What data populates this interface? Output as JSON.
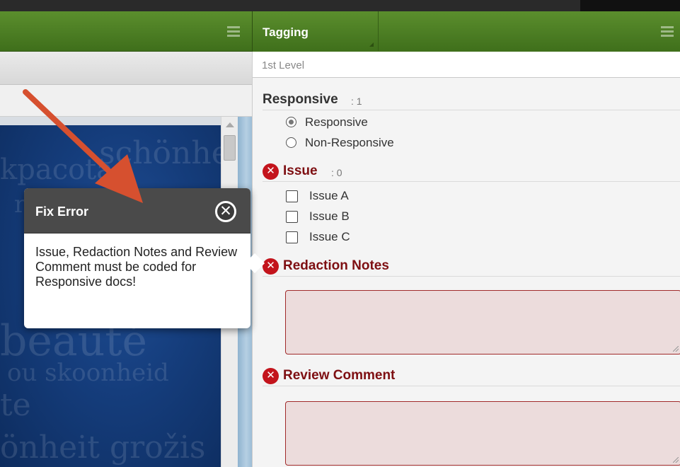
{
  "tagging_pane": {
    "title": "Tagging",
    "level_label": "1st Level",
    "fields": {
      "responsive": {
        "label": "Responsive",
        "count": ": 1",
        "options": [
          "Responsive",
          "Non-Responsive"
        ],
        "selected": "Responsive"
      },
      "issue": {
        "label": "Issue",
        "count": ": 0",
        "options": [
          "Issue A",
          "Issue B",
          "Issue C"
        ]
      },
      "redaction_notes": {
        "label": "Redaction Notes"
      },
      "review_comment": {
        "label": "Review Comment"
      }
    }
  },
  "error_popup": {
    "title": "Fix Error",
    "message": "Issue, Redaction Notes and Review Comment must be coded for Responsive docs!"
  },
  "colors": {
    "header_green": "#4f8126",
    "error_red": "#c3141c",
    "error_text": "#7e0f12",
    "arrow": "#d6502f"
  }
}
